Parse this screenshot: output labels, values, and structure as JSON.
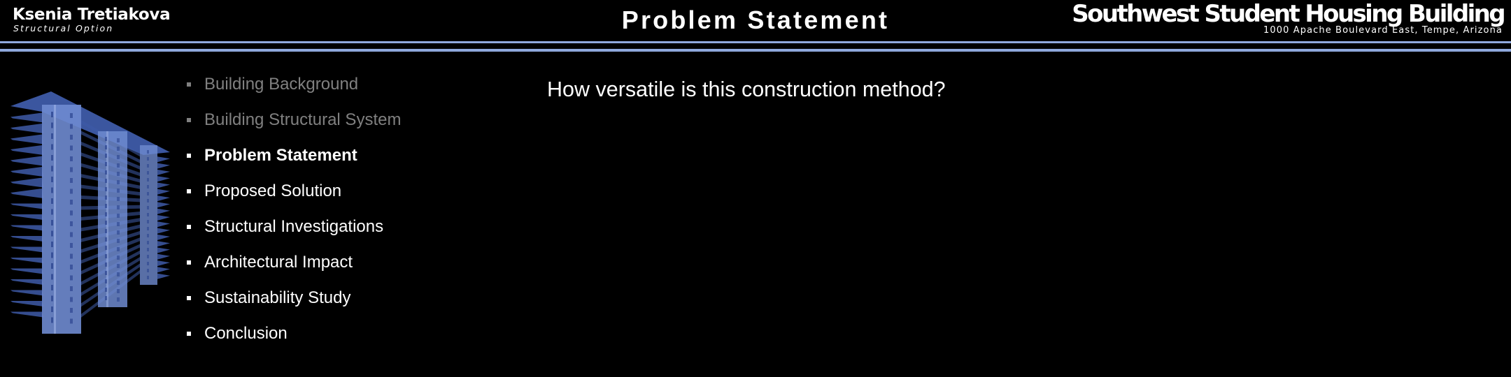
{
  "header": {
    "author_name": "Ksenia Tretiakova",
    "author_option": "Structural Option",
    "slide_title": "Problem Statement",
    "project_title": "Southwest Student Housing Building",
    "project_address": "1000 Apache Boulevard East, Tempe, Arizona"
  },
  "colors": {
    "accent_rule": "#8FA8DC",
    "building_slab": "#3E5BA8",
    "building_facade": "#6F8BD0",
    "visited_item": "#808080",
    "background": "#000000"
  },
  "illustration": {
    "icon": "building-model-icon",
    "description": "3D structural model of the building"
  },
  "toc": {
    "items": [
      {
        "label": "Building Background",
        "state": "visited"
      },
      {
        "label": "Building Structural System",
        "state": "visited"
      },
      {
        "label": "Problem Statement",
        "state": "current"
      },
      {
        "label": "Proposed Solution",
        "state": "upcoming"
      },
      {
        "label": "Structural Investigations",
        "state": "upcoming"
      },
      {
        "label": "Architectural Impact",
        "state": "upcoming"
      },
      {
        "label": "Sustainability Study",
        "state": "upcoming"
      },
      {
        "label": "Conclusion",
        "state": "upcoming"
      }
    ]
  },
  "main": {
    "question": "How versatile is this construction method?"
  }
}
